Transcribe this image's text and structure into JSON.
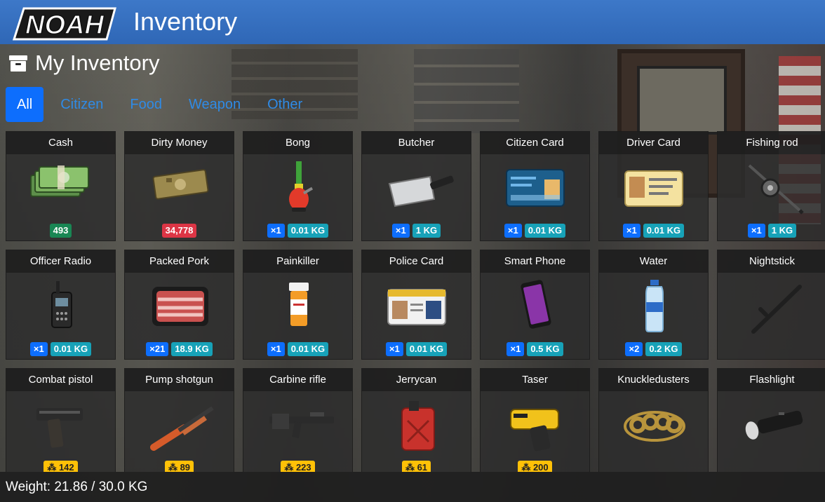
{
  "app": {
    "logo_text": "NOAH",
    "title": "Inventory"
  },
  "section": {
    "title": "My Inventory",
    "icon": "archive-box-icon"
  },
  "tabs": [
    {
      "label": "All",
      "active": true
    },
    {
      "label": "Citizen",
      "active": false
    },
    {
      "label": "Food",
      "active": false
    },
    {
      "label": "Weapon",
      "active": false
    },
    {
      "label": "Other",
      "active": false
    }
  ],
  "items": [
    {
      "name": "Cash",
      "icon": "cash-stack-icon",
      "badges": [
        {
          "text": "493",
          "style": "green"
        }
      ]
    },
    {
      "name": "Dirty Money",
      "icon": "dirty-money-icon",
      "badges": [
        {
          "text": "34,778",
          "style": "red"
        }
      ]
    },
    {
      "name": "Bong",
      "icon": "bong-icon",
      "badges": [
        {
          "text": "×1",
          "style": "blue"
        },
        {
          "text": "0.01 KG",
          "style": "teal"
        }
      ]
    },
    {
      "name": "Butcher",
      "icon": "cleaver-icon",
      "badges": [
        {
          "text": "×1",
          "style": "blue"
        },
        {
          "text": "1 KG",
          "style": "teal"
        }
      ]
    },
    {
      "name": "Citizen Card",
      "icon": "citizen-card-icon",
      "badges": [
        {
          "text": "×1",
          "style": "blue"
        },
        {
          "text": "0.01 KG",
          "style": "teal"
        }
      ]
    },
    {
      "name": "Driver Card",
      "icon": "driver-card-icon",
      "badges": [
        {
          "text": "×1",
          "style": "blue"
        },
        {
          "text": "0.01 KG",
          "style": "teal"
        }
      ]
    },
    {
      "name": "Fishing rod",
      "icon": "fishing-rod-icon",
      "badges": [
        {
          "text": "×1",
          "style": "blue"
        },
        {
          "text": "1 KG",
          "style": "teal"
        }
      ]
    },
    {
      "name": "Officer Radio",
      "icon": "radio-icon",
      "badges": [
        {
          "text": "×1",
          "style": "blue"
        },
        {
          "text": "0.01 KG",
          "style": "teal"
        }
      ]
    },
    {
      "name": "Packed Pork",
      "icon": "packed-pork-icon",
      "badges": [
        {
          "text": "×21",
          "style": "blue"
        },
        {
          "text": "18.9 KG",
          "style": "teal"
        }
      ]
    },
    {
      "name": "Painkiller",
      "icon": "pill-bottle-icon",
      "badges": [
        {
          "text": "×1",
          "style": "blue"
        },
        {
          "text": "0.01 KG",
          "style": "teal"
        }
      ]
    },
    {
      "name": "Police Card",
      "icon": "police-card-icon",
      "badges": [
        {
          "text": "×1",
          "style": "blue"
        },
        {
          "text": "0.01 KG",
          "style": "teal"
        }
      ]
    },
    {
      "name": "Smart Phone",
      "icon": "smartphone-icon",
      "badges": [
        {
          "text": "×1",
          "style": "blue"
        },
        {
          "text": "0.5 KG",
          "style": "teal"
        }
      ]
    },
    {
      "name": "Water",
      "icon": "water-bottle-icon",
      "badges": [
        {
          "text": "×2",
          "style": "blue"
        },
        {
          "text": "0.2 KG",
          "style": "teal"
        }
      ]
    },
    {
      "name": "Nightstick",
      "icon": "nightstick-icon",
      "badges": []
    },
    {
      "name": "Combat pistol",
      "icon": "pistol-icon",
      "badges": [
        {
          "text": "⁂ 142",
          "style": "yellow"
        }
      ]
    },
    {
      "name": "Pump shotgun",
      "icon": "shotgun-icon",
      "badges": [
        {
          "text": "⁂ 89",
          "style": "yellow"
        }
      ]
    },
    {
      "name": "Carbine rifle",
      "icon": "rifle-icon",
      "badges": [
        {
          "text": "⁂ 223",
          "style": "yellow"
        }
      ]
    },
    {
      "name": "Jerrycan",
      "icon": "jerrycan-icon",
      "badges": [
        {
          "text": "⁂ 61",
          "style": "yellow"
        }
      ]
    },
    {
      "name": "Taser",
      "icon": "taser-icon",
      "badges": [
        {
          "text": "⁂ 200",
          "style": "yellow"
        }
      ]
    },
    {
      "name": "Knuckledusters",
      "icon": "knuckledusters-icon",
      "badges": []
    },
    {
      "name": "Flashlight",
      "icon": "flashlight-icon",
      "badges": []
    }
  ],
  "footer": {
    "weight_text": "Weight: 21.86 / 30.0 KG"
  },
  "colors": {
    "topbar": "#3d78c8",
    "tab_active": "#0d6efd",
    "tab_text": "#2f8be6"
  }
}
